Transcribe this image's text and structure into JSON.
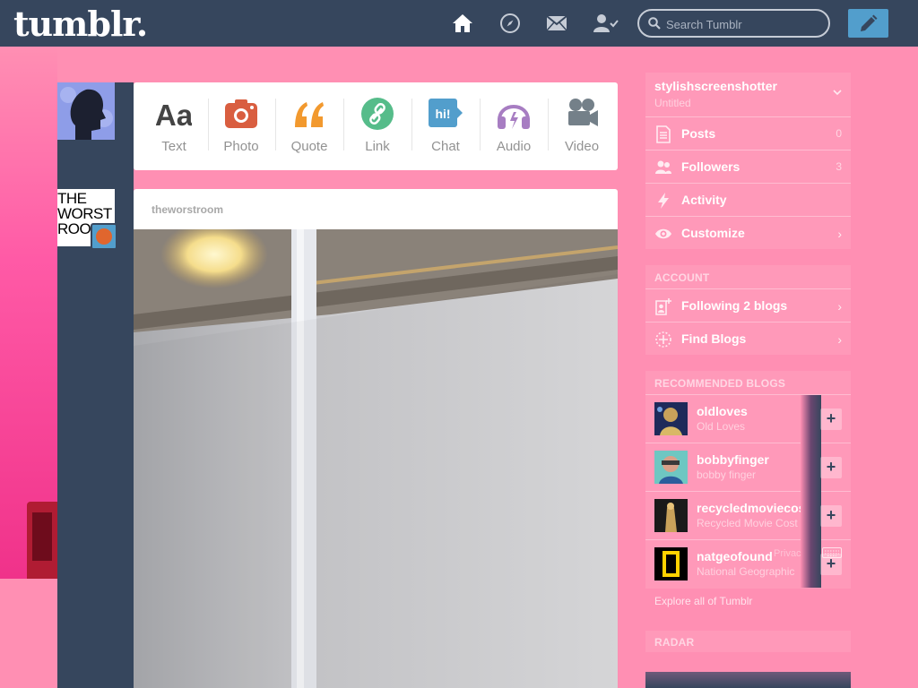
{
  "topbar": {
    "logo": "tumblr.",
    "nav_icons": [
      "home-icon",
      "explore-compass-icon",
      "inbox-mail-icon",
      "account-icon"
    ],
    "search_placeholder": "Search Tumblr",
    "compose_icon": "pencil-icon"
  },
  "post_types": [
    {
      "label": "Text",
      "icon": "text-icon",
      "color": "#444444"
    },
    {
      "label": "Photo",
      "icon": "camera-icon",
      "color": "#d95e40"
    },
    {
      "label": "Quote",
      "icon": "quote-icon",
      "color": "#f2992e"
    },
    {
      "label": "Link",
      "icon": "link-icon",
      "color": "#56bc8a"
    },
    {
      "label": "Chat",
      "icon": "chat-icon",
      "color": "#529ecc",
      "glyph": "hi!"
    },
    {
      "label": "Audio",
      "icon": "headphones-icon",
      "color": "#a77dc2"
    },
    {
      "label": "Video",
      "icon": "video-camera-icon",
      "color": "#748089"
    }
  ],
  "post": {
    "blog_name": "theworstroom",
    "avatar_text": "THE WORST ROOM"
  },
  "sidebar": {
    "blog": {
      "name": "stylishscreenshotter",
      "subtitle": "Untitled",
      "rows": [
        {
          "label": "Posts",
          "count": "0",
          "icon": "document-icon"
        },
        {
          "label": "Followers",
          "count": "3",
          "icon": "people-icon"
        },
        {
          "label": "Activity",
          "count": "",
          "icon": "lightning-icon"
        },
        {
          "label": "Customize",
          "count": "",
          "icon": "eye-icon",
          "chevron": "›"
        }
      ]
    },
    "account": {
      "heading": "ACCOUNT",
      "rows": [
        {
          "label": "Following 2 blogs",
          "icon": "following-icon",
          "chevron": "›"
        },
        {
          "label": "Find Blogs",
          "icon": "find-blogs-icon",
          "chevron": "›"
        }
      ]
    },
    "recommended": {
      "heading": "RECOMMENDED BLOGS",
      "blogs": [
        {
          "name": "oldloves",
          "title": "Old Loves",
          "follow": "+"
        },
        {
          "name": "bobbyfinger",
          "title": "bobby finger",
          "follow": "+"
        },
        {
          "name": "recycledmoviecost",
          "title": "Recycled Movie Cost",
          "follow": "+"
        },
        {
          "name": "natgeofound",
          "title": "National Geographic",
          "follow": "+",
          "overlay": "Privac"
        }
      ],
      "explore": "Explore all of Tumblr"
    },
    "radar": {
      "heading": "RADAR"
    }
  },
  "colors": {
    "topbar": "#36465d",
    "background": "#ff8fb3",
    "accent_blue": "#529ecc"
  }
}
